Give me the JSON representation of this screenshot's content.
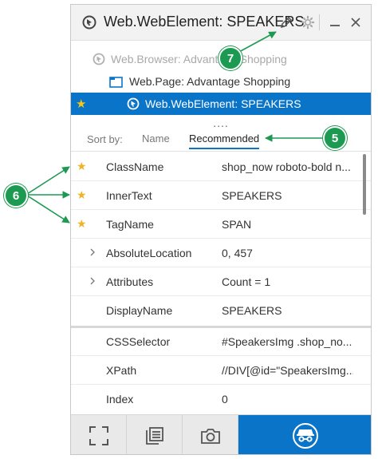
{
  "window": {
    "title": "Web.WebElement: SPEAKERS"
  },
  "tree": [
    {
      "label": "Web.Browser:  Advantage Shopping",
      "state": "dim"
    },
    {
      "label": "Web.Page:  Advantage Shopping",
      "state": "normal"
    },
    {
      "label": "Web.WebElement: SPEAKERS",
      "state": "selected"
    }
  ],
  "splitter_dots": "....",
  "sort": {
    "label": "Sort by:",
    "options": [
      "Name",
      "Recommended"
    ],
    "active": "Recommended"
  },
  "properties": [
    {
      "name": "ClassName",
      "value": "shop_now roboto-bold n...",
      "starred": true,
      "expandable": false
    },
    {
      "name": "InnerText",
      "value": "SPEAKERS",
      "starred": true,
      "expandable": false
    },
    {
      "name": "TagName",
      "value": "SPAN",
      "starred": true,
      "expandable": false
    },
    {
      "name": "AbsoluteLocation",
      "value": "0, 457",
      "starred": false,
      "expandable": true
    },
    {
      "name": "Attributes",
      "value": "Count = 1",
      "starred": false,
      "expandable": true
    },
    {
      "name": "DisplayName",
      "value": "SPEAKERS",
      "starred": false,
      "expandable": false
    },
    {
      "name": "CSSSelector",
      "value": "#SpeakersImg .shop_no...",
      "starred": false,
      "expandable": false
    },
    {
      "name": "XPath",
      "value": "//DIV[@id=\"SpeakersImg...",
      "starred": false,
      "expandable": false
    },
    {
      "name": "Index",
      "value": "0",
      "starred": false,
      "expandable": false
    }
  ],
  "callouts": {
    "five": "5",
    "six": "6",
    "seven": "7"
  },
  "colors": {
    "accent": "#0a74c8",
    "callout": "#1d9a52",
    "star": "#f0b323"
  }
}
